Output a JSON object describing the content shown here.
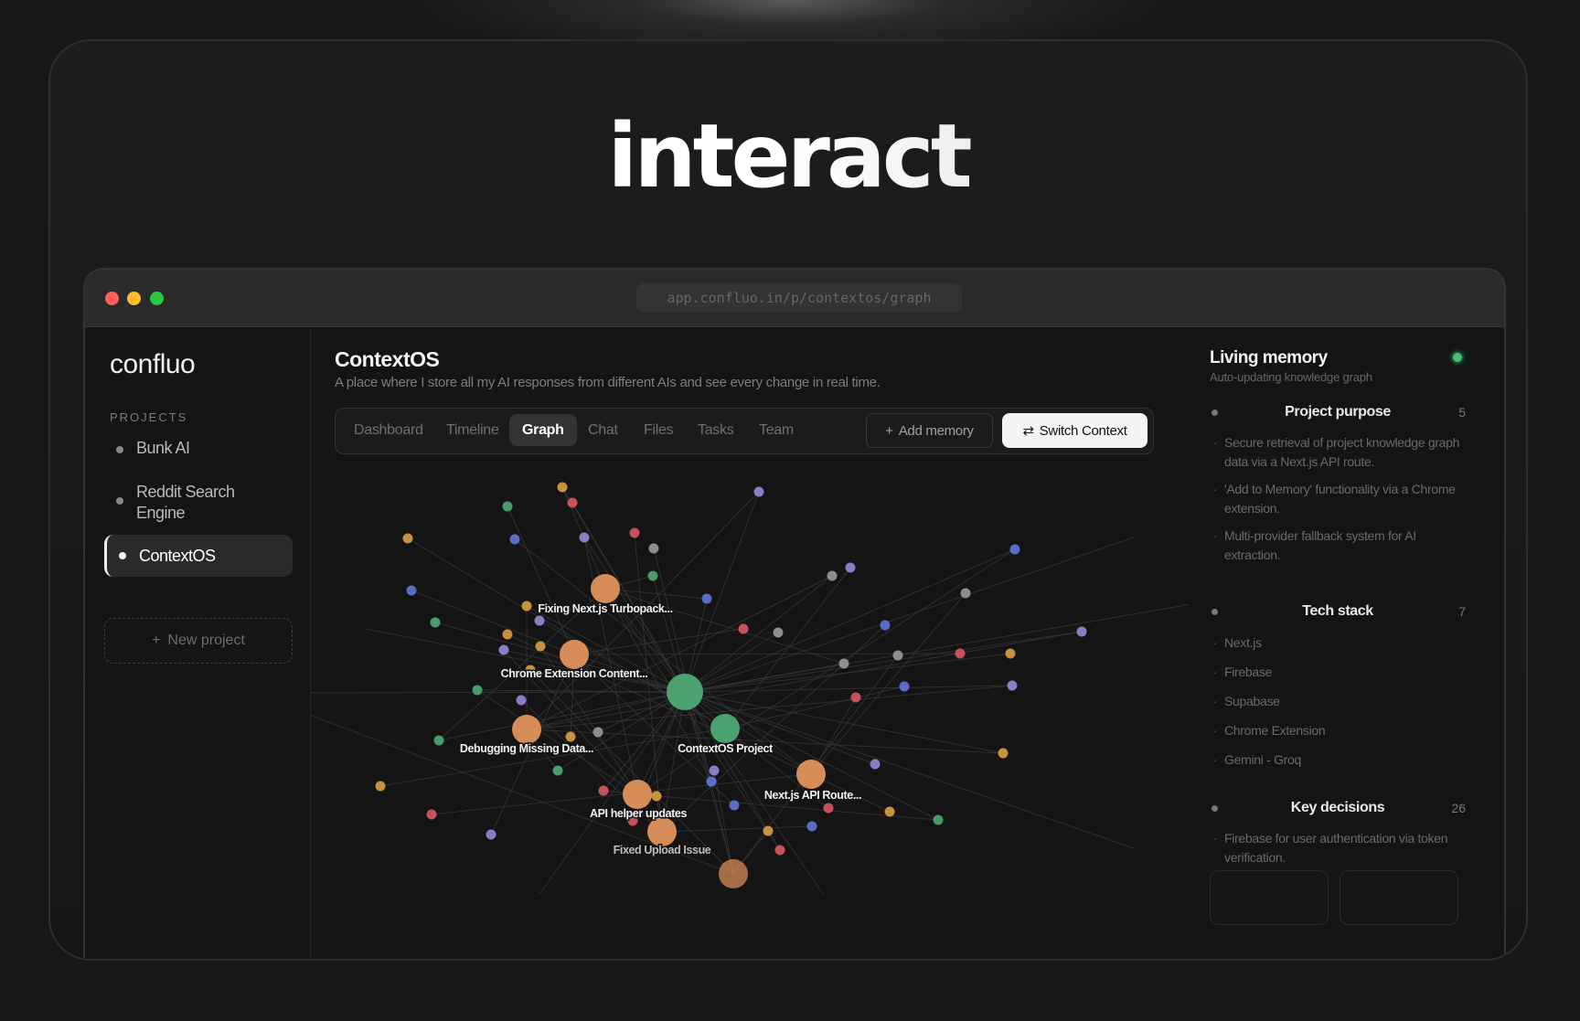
{
  "headline": "interact",
  "browser": {
    "url": "app.confluo.in/p/contextos/graph"
  },
  "sidebar": {
    "brand": "confluo",
    "section_label": "PROJECTS",
    "projects": [
      {
        "label": "Bunk AI"
      },
      {
        "label": "Reddit Search Engine"
      },
      {
        "label": "ContextOS",
        "active": true
      }
    ],
    "new_project": "New project"
  },
  "main": {
    "title": "ContextOS",
    "subtitle": "A place where I store all my AI responses from different AIs and see every change in real time.",
    "tabs": [
      {
        "label": "Dashboard"
      },
      {
        "label": "Timeline"
      },
      {
        "label": "Graph",
        "active": true
      },
      {
        "label": "Chat"
      },
      {
        "label": "Files"
      },
      {
        "label": "Tasks"
      },
      {
        "label": "Team"
      }
    ],
    "add_memory": "Add memory",
    "switch_context": "Switch Context",
    "graph_labels": [
      "Fixing Next.js Turbopack...",
      "Chrome Extension Content...",
      "Debugging Missing Data...",
      "ContextOS Project",
      "Next.js API Route...",
      "API helper updates",
      "Fixed Upload Issue"
    ]
  },
  "panel": {
    "title": "Living memory",
    "subtitle": "Auto-updating knowledge graph",
    "sections": [
      {
        "title": "Project purpose",
        "count": "5",
        "items": [
          "Secure retrieval of project knowledge graph data via a Next.js API route.",
          "'Add to Memory' functionality via a Chrome extension.",
          "Multi-provider fallback system for AI extraction."
        ]
      },
      {
        "title": "Tech stack",
        "count": "7",
        "items": [
          "Next.js",
          "Firebase",
          "Supabase",
          "Chrome Extension",
          "Gemini - Groq"
        ]
      },
      {
        "title": "Key decisions",
        "count": "26",
        "items": [
          "Firebase for user authentication via token verification."
        ]
      }
    ]
  },
  "colors": {
    "orange": "#e0925a",
    "green": "#4faa73",
    "red": "#d85860",
    "blue": "#5f78d8",
    "purple": "#9a86d6",
    "gray": "#9a9a9a",
    "yellow": "#d9a045"
  },
  "icons": {
    "plus": "plus-icon",
    "switch": "swap-arrows-icon",
    "live": "status-dot-icon"
  }
}
